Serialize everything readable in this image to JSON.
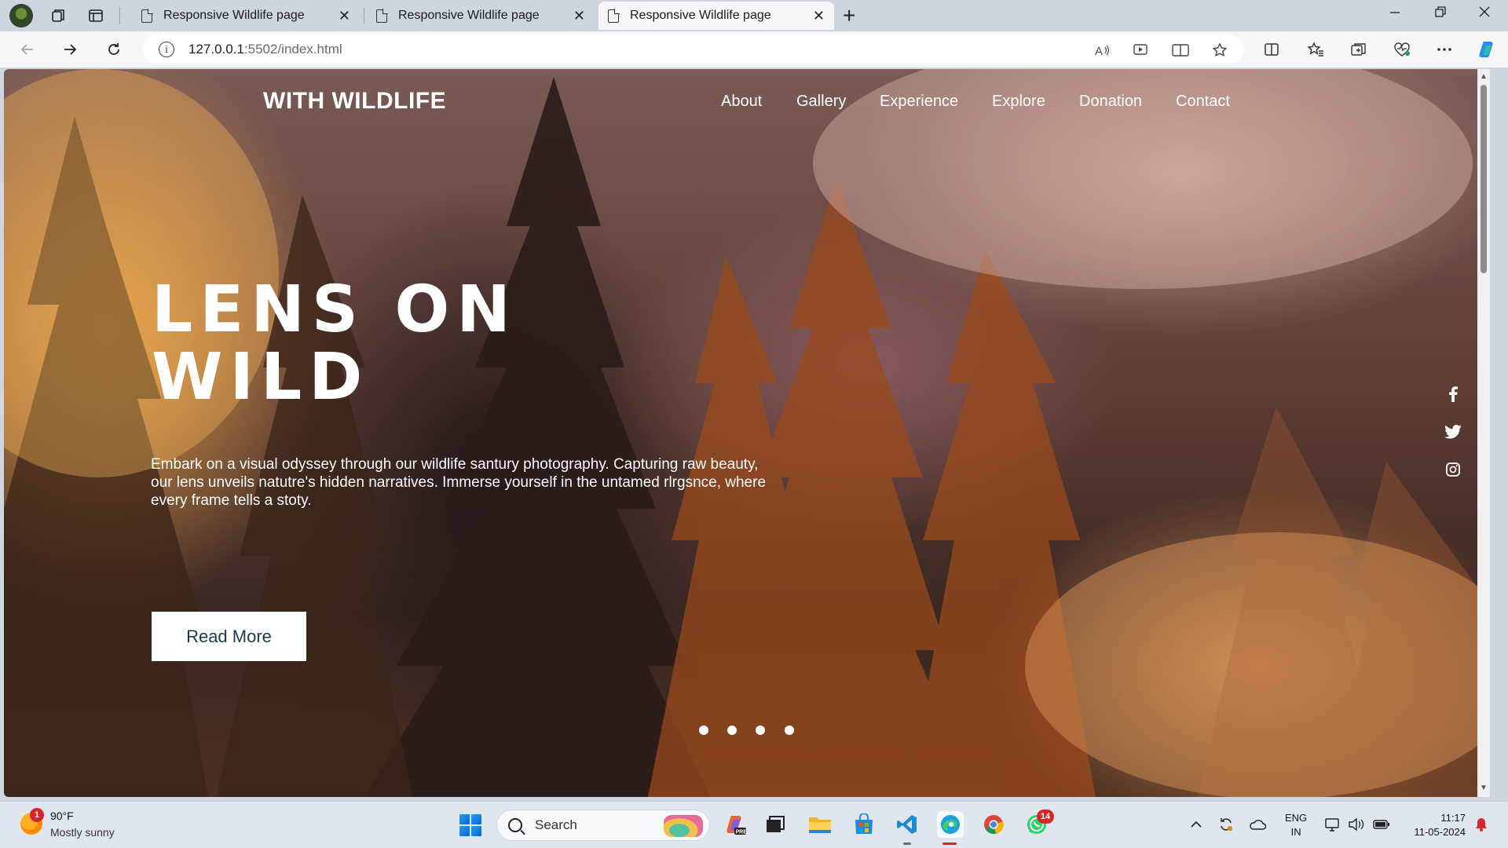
{
  "browser": {
    "tabs": [
      {
        "title": "Responsive Wildlife page",
        "active": false
      },
      {
        "title": "Responsive Wildlife page",
        "active": false
      },
      {
        "title": "Responsive Wildlife page",
        "active": true
      }
    ],
    "url_host": "127.0.0.1",
    "url_rest": ":5502/index.html",
    "close_glyph": "✕",
    "new_tab_glyph": "+"
  },
  "site": {
    "logo": "WITH WILDLIFE",
    "nav": [
      "About",
      "Gallery",
      "Experience",
      "Explore",
      "Donation",
      "Contact"
    ],
    "hero": {
      "title_line1": "LENS ON",
      "title_line2": "WILD",
      "text": "Embark on a visual odyssey through our wildlife santury photography. Capturing raw beauty, our lens unveils natutre's hidden narratives. Immerse yourself in the untamed rlrgsnce, where every frame tells a stoty.",
      "button": "Read More"
    },
    "social": [
      "facebook-icon",
      "twitter-icon",
      "instagram-icon"
    ],
    "slider_dots": 4
  },
  "taskbar": {
    "weather_badge": "1",
    "temperature": "90°F",
    "weather": "Mostly sunny",
    "search_label": "Search",
    "whatsapp_badge": "14",
    "lang_line1": "ENG",
    "lang_line2": "IN",
    "time": "11:17",
    "date": "11-05-2024"
  },
  "colors": {
    "button_text": "#1b3a4d",
    "tab_active_bg": "#f7f7f7",
    "tabstrip_bg": "#cdd5de",
    "taskbar_bg": "#dfe6ee",
    "badge_red": "#d6262c"
  }
}
